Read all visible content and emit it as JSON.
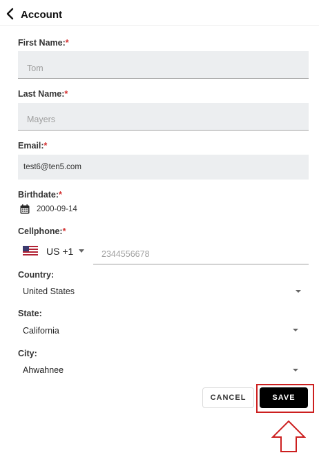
{
  "header": {
    "title": "Account",
    "back_icon": "chevron-left-icon"
  },
  "form": {
    "first_name": {
      "label": "First Name:",
      "required": "*",
      "value": "Tom"
    },
    "last_name": {
      "label": "Last Name:",
      "required": "*",
      "value": "Mayers"
    },
    "email": {
      "label": "Email:",
      "required": "*",
      "value": "test6@ten5.com"
    },
    "birthdate": {
      "label": "Birthdate:",
      "required": "*",
      "value": "2000-09-14",
      "icon": "calendar-icon"
    },
    "cellphone": {
      "label": "Cellphone:",
      "required": "*",
      "country_code": "US +1",
      "flag": "us-flag-icon",
      "placeholder": "2344556678"
    },
    "country": {
      "label": "Country:",
      "value": "United States"
    },
    "state": {
      "label": "State:",
      "value": "California"
    },
    "city": {
      "label": "City:",
      "value": "Ahwahnee"
    }
  },
  "actions": {
    "cancel": "CANCEL",
    "save": "SAVE"
  },
  "annotation": {
    "highlight_color": "#cc1f1f",
    "icon": "arrow-up-outline-icon"
  }
}
